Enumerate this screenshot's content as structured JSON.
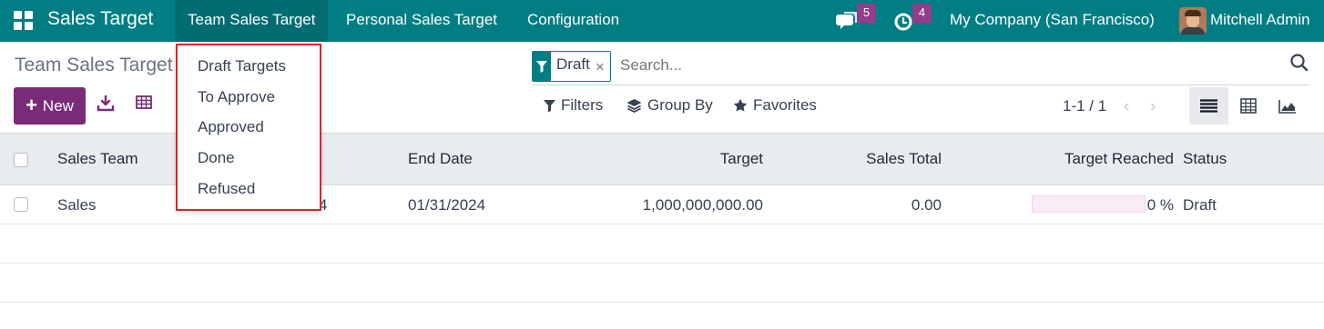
{
  "navbar": {
    "app_title": "Sales Target",
    "menu": [
      "Team Sales Target",
      "Personal Sales Target",
      "Configuration"
    ],
    "messages_badge": "5",
    "activities_badge": "4",
    "company": "My Company (San Francisco)",
    "user": "Mitchell Admin"
  },
  "breadcrumb": "Team Sales Target",
  "buttons": {
    "new_label": "New"
  },
  "search": {
    "facet_value": "Draft",
    "facet_remove": "×",
    "placeholder": "Search..."
  },
  "filters": {
    "filters_label": "Filters",
    "group_by_label": "Group By",
    "favorites_label": "Favorites"
  },
  "pager": {
    "text": "1-1 / 1"
  },
  "table": {
    "headers": [
      "Sales Team",
      "End Date",
      "Target",
      "Sales Total",
      "Target Reached",
      "Status"
    ],
    "rows": [
      {
        "sales_team": "Sales",
        "start_date_tail": "4",
        "end_date": "01/31/2024",
        "target": "1,000,000,000.00",
        "sales_total": "0.00",
        "target_reached": "0 %",
        "target_reached_value": 0,
        "status": "Draft"
      }
    ]
  },
  "dropdown": {
    "items": [
      "Draft Targets",
      "To Approve",
      "Approved",
      "Done",
      "Refused"
    ]
  },
  "colors": {
    "navbar": "#017e84",
    "primary": "#7a2b78",
    "badge": "#8f3e8a",
    "highlight_border": "#d9262b"
  }
}
